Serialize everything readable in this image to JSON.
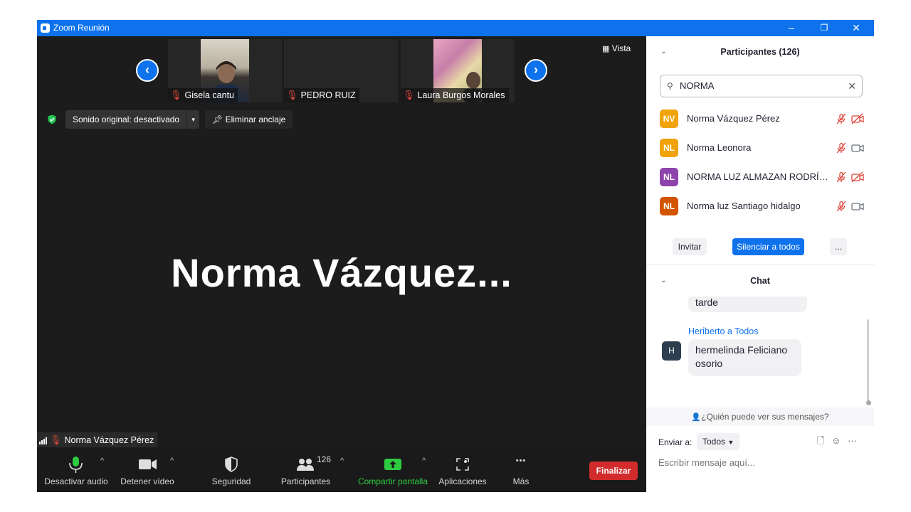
{
  "window": {
    "title": "Zoom Reunión",
    "minimize_glyph": "–",
    "restore_glyph": "❐",
    "close_glyph": "✕"
  },
  "gallery": {
    "thumbnails": [
      {
        "name": "Gisela cantu"
      },
      {
        "name": "PEDRO RUIZ"
      },
      {
        "name": "Laura Burgos Morales"
      }
    ],
    "view_label": "Vista",
    "prev_glyph": "‹",
    "next_glyph": "›"
  },
  "audio_pill": {
    "label": "Sonido original: desactivado",
    "caret": "▾"
  },
  "unpin_label": "Eliminar anclaje",
  "active_speaker": "Norma  Vázquez...",
  "self_tag": "Norma Vázquez Pérez",
  "toolbar": {
    "mute_label": "Desactivar audio",
    "video_label": "Detener vídeo",
    "security_label": "Seguridad",
    "participants_label": "Participantes",
    "participants_count": "126",
    "share_label": "Compartir pantalla",
    "apps_label": "Aplicaciones",
    "more_label": "Más",
    "end_label": "Finalizar",
    "caret": "^",
    "more_glyph": "•••"
  },
  "participants_panel": {
    "title": "Participantes (126)",
    "search_value": "NORMA",
    "chevron": "⌄",
    "search_icon": "⚲",
    "clear_icon": "✕",
    "rows": [
      {
        "initials": "NV",
        "name": "Norma Vázquez Pérez",
        "color": "#f0a30a",
        "video_off": true
      },
      {
        "initials": "NL",
        "name": "Norma Leonora",
        "color": "#f0a30a",
        "video_off": false
      },
      {
        "initials": "NL",
        "name": "NORMA LUZ ALMAZAN RODRÍG...",
        "color": "#8e44ad",
        "video_off": true
      },
      {
        "initials": "NL",
        "name": "Norma luz Santiago hidalgo",
        "color": "#d35400",
        "video_off": false
      }
    ],
    "invite_label": "Invitar",
    "mute_all_label": "Silenciar a todos",
    "more_label": "..."
  },
  "chat": {
    "title": "Chat",
    "prev_tail": "tarde",
    "sender": "Heriberto a Todos",
    "avatar_initial": "H",
    "message_line1": "hermelinda Feliciano",
    "message_line2": "osorio",
    "who_can_see": "¿Quién puede ver sus mensajes?",
    "send_to_label": "Enviar a:",
    "send_to_value": "Todos",
    "compose_placeholder": "Escribir mensaje aquí...",
    "file_icon": "🗋",
    "emoji_icon": "☺",
    "more_icon": "···",
    "person_icon": "👤"
  },
  "colors": {
    "zoom_blue": "#0e72ed",
    "end_red": "#d12b2b",
    "mute_red": "#e0483e",
    "share_green": "#2ecc40"
  }
}
